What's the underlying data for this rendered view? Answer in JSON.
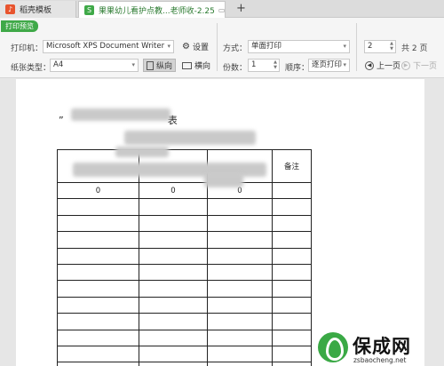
{
  "tabs": [
    {
      "label": "稻壳模板",
      "icon_color": "#e8542e",
      "icon_glyph": "♪"
    },
    {
      "label": "果果幼儿看护点教...老师收-2.25",
      "icon_color": "#3fa948",
      "icon_glyph": "S",
      "active": true,
      "unsaved": true
    }
  ],
  "toolbar": {
    "print_preview_tag": "打印预览",
    "printer_label": "打印机：",
    "printer_value": "Microsoft XPS Document Writer",
    "settings_label": "设置",
    "paper_type_label": "纸张类型：",
    "paper_type_value": "A4",
    "portrait_label": "纵向",
    "landscape_label": "横向",
    "mode_label": "方式：",
    "mode_value": "单面打印",
    "copies_label": "份数：",
    "copies_value": "1",
    "order_label": "顺序：",
    "order_value": "逐页打印",
    "page_value": "2",
    "total_pages_label": "共 2 页",
    "prev_page_label": "上一页",
    "next_page_label": "下一页"
  },
  "document": {
    "title_prefix": "”",
    "title_suffix": "表",
    "remark_header": "备注",
    "first_row_values": [
      "0",
      "0",
      "0"
    ]
  },
  "watermark": {
    "name": "保成网",
    "url": "zsbaocheng.net",
    "logo_color": "#3aa945"
  }
}
